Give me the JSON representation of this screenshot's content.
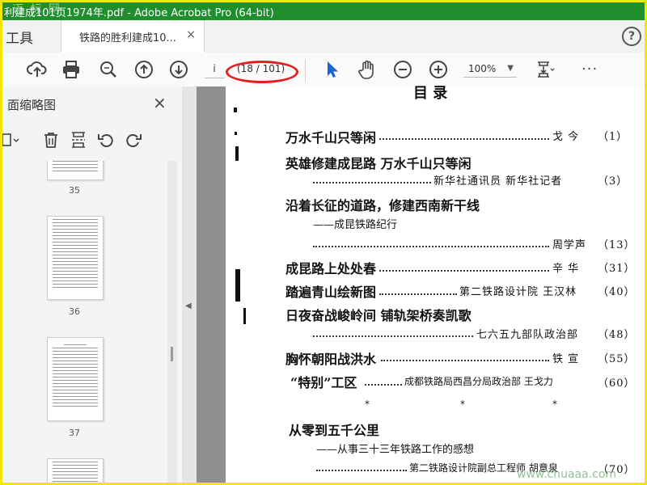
{
  "window": {
    "title": "利建成101页1974年.pdf - Adobe Acrobat Pro (64-bit)",
    "watermark": "迈 标 网"
  },
  "tabs": {
    "tools": "工具",
    "document": "铁路的胜利建成10...",
    "close": "×",
    "help": "?"
  },
  "toolbar": {
    "page_input": "i",
    "page_count": "(18 / 101)",
    "zoom": "100%",
    "more": "···",
    "icons": [
      "upload-icon",
      "print-icon",
      "zoom-search-icon",
      "page-up-icon",
      "page-down-icon",
      "select-arrow-icon",
      "hand-icon",
      "zoom-out-icon",
      "zoom-in-icon",
      "fit-page-icon"
    ]
  },
  "left_panel": {
    "title": "面缩略图",
    "close": "×",
    "thumbnails": [
      {
        "page": "35"
      },
      {
        "page": "36"
      },
      {
        "page": "37"
      }
    ]
  },
  "document": {
    "top_heading": "目      录",
    "entries": [
      {
        "title": "万水千山只等闲",
        "author": "戈    今",
        "page": "（1）"
      },
      {
        "title": "英雄修建成昆路    万水千山只等闲",
        "author": "新华社通讯员    新华社记者",
        "page": "（3）"
      },
      {
        "title": "沿着长征的道路，修建西南新干线",
        "subtitle": "——成昆铁路纪行",
        "author": "周学声",
        "page": "（13）"
      },
      {
        "title": "成昆路上处处春",
        "author": "辛    华",
        "page": "（31）"
      },
      {
        "title": "踏遍青山绘新图",
        "author": "第二铁路设计院    王汉林",
        "page": "（40）"
      },
      {
        "title": "日夜奋战峻岭间    铺轨架桥奏凯歌",
        "author": "七六五九部队政治部",
        "page": "（48）"
      },
      {
        "title": "胸怀朝阳战洪水",
        "author": "铁    宣",
        "page": "（55）"
      },
      {
        "title": "“特别”工区",
        "author": "成都铁路局西昌分局政治部    王戈力",
        "page": "（60）"
      },
      {
        "title": "从零到五千公里",
        "subtitle": "——从事三十三年铁路工作的感想",
        "author": "第二铁路设计院副总工程师    胡意泉",
        "page": "（70）"
      }
    ],
    "separator": "*",
    "watermark": "www.chuaaa.com"
  }
}
